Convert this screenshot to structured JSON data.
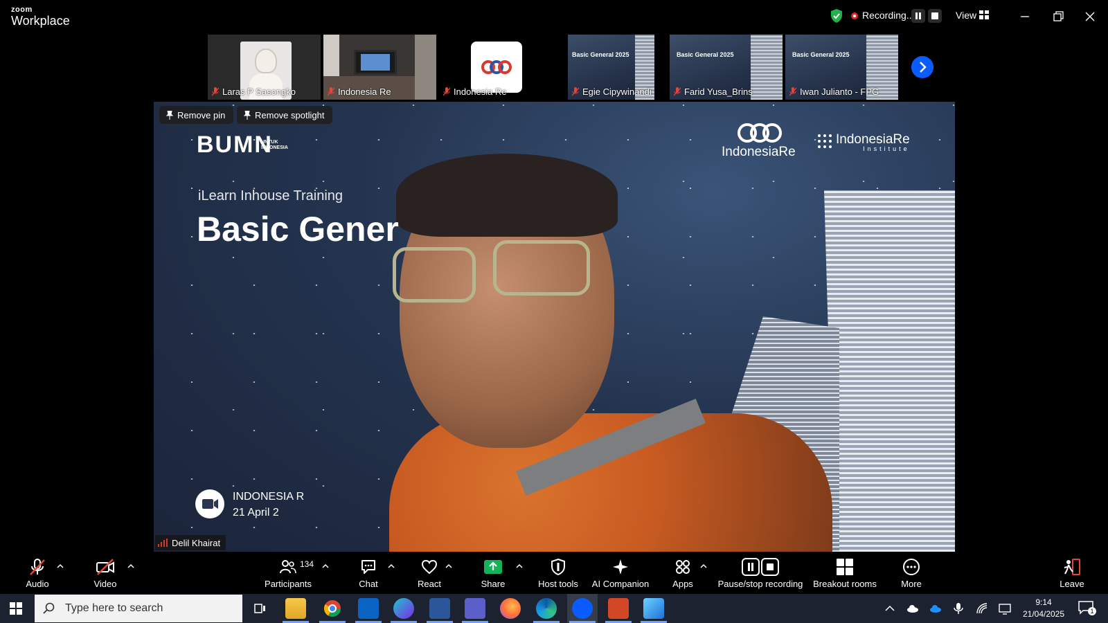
{
  "app": {
    "brand_small": "zoom",
    "brand_name": "Workplace"
  },
  "titlebar": {
    "recording_label": "Recording...",
    "view_label": "View"
  },
  "thumbnails": [
    {
      "name": "Laras P Sasongko"
    },
    {
      "name": "Indonesia Re"
    },
    {
      "name": "Indonesia Re"
    },
    {
      "name": "Egie Cipywinandi"
    },
    {
      "name": "Farid Yusa_Brins"
    },
    {
      "name": "Iwan Julianto - FPG"
    }
  ],
  "main_video": {
    "remove_pin": "Remove pin",
    "remove_spotlight": "Remove spotlight",
    "speaker_name": "Delil Khairat",
    "slide": {
      "bumn": "BUMN",
      "bumn_sub_1": "UNTUK",
      "bumn_sub_2": "INDONESIA",
      "program": "iLearn Inhouse Training",
      "title_visible": "Basic Gener",
      "logo_1": "IndonesiaRe",
      "logo_2": "IndonesiaRe",
      "logo_2_sub": "Institute",
      "footer_org": "INDONESIA R",
      "footer_date": "21 April 2"
    }
  },
  "toolbar": {
    "audio": "Audio",
    "video": "Video",
    "participants": "Participants",
    "participants_count": "134",
    "chat": "Chat",
    "react": "React",
    "share": "Share",
    "host_tools": "Host tools",
    "ai_companion": "AI Companion",
    "apps": "Apps",
    "pause_stop": "Pause/stop recording",
    "breakout": "Breakout rooms",
    "more": "More",
    "leave": "Leave"
  },
  "taskbar": {
    "search_placeholder": "Type here to search",
    "time": "9:14",
    "date": "21/04/2025",
    "notifications": "1"
  },
  "colors": {
    "zoom_blue": "#0b5cff",
    "recording_red": "#e02828",
    "share_green": "#12b35b",
    "leave_red": "#e8443a"
  }
}
